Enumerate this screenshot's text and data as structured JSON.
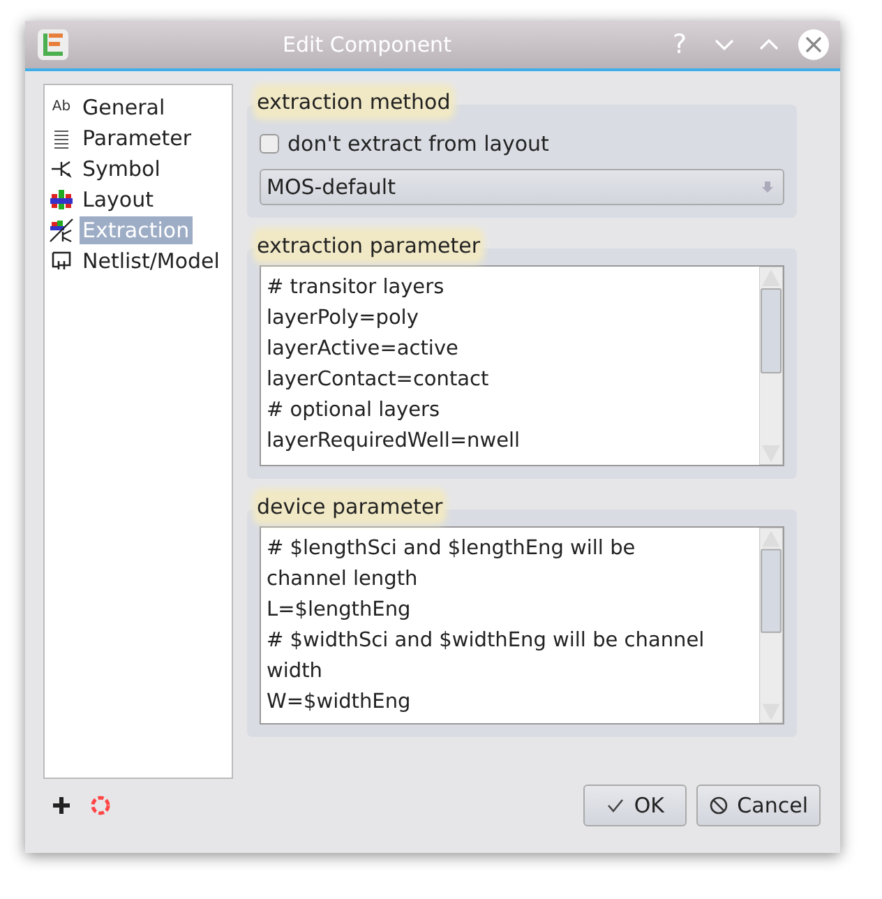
{
  "window": {
    "title": "Edit Component",
    "help": "?"
  },
  "sidebar": {
    "items": [
      {
        "kind": "text",
        "icon_text": "Ab",
        "label": "General",
        "selected": false
      },
      {
        "kind": "list",
        "label": "Parameter",
        "selected": false
      },
      {
        "kind": "symbol",
        "label": "Symbol",
        "selected": false
      },
      {
        "kind": "layout",
        "label": "Layout",
        "selected": false
      },
      {
        "kind": "extraction",
        "label": "Extraction",
        "selected": true
      },
      {
        "kind": "netlist",
        "label": "Netlist/Model",
        "selected": false
      }
    ]
  },
  "extraction_method": {
    "title": "extraction method",
    "checkbox": {
      "label": "don't extract from layout",
      "checked": false
    },
    "dropdown": {
      "value": "MOS-default"
    }
  },
  "extraction_parameter": {
    "title": "extraction parameter",
    "lines": [
      "# transitor layers",
      "layerPoly=poly",
      "layerActive=active",
      "layerContact=contact",
      "# optional layers",
      "layerRequiredWell=nwell"
    ]
  },
  "device_parameter": {
    "title": "device parameter",
    "lines": [
      "# $lengthSci and $lengthEng will be",
      "channel length",
      "L=$lengthEng",
      "# $widthSci and $widthEng will be channel",
      "width",
      "W=$widthEng"
    ]
  },
  "buttons": [
    {
      "kind": "ok",
      "label": "OK"
    },
    {
      "kind": "cancel",
      "label": "Cancel"
    }
  ]
}
